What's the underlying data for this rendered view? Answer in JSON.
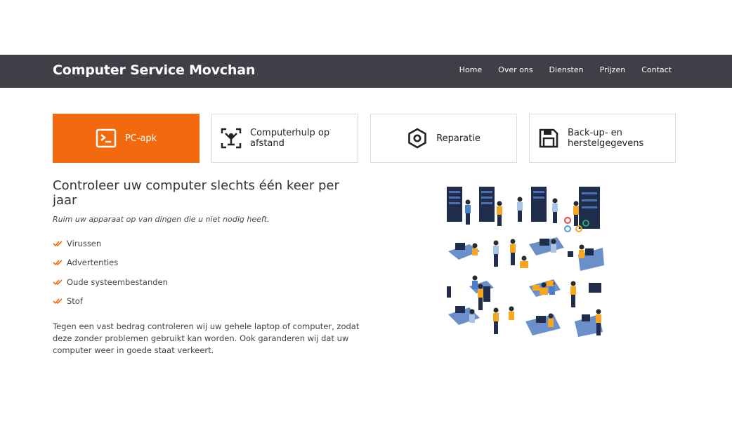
{
  "header": {
    "brand": "Computer Service Movchan",
    "nav": [
      "Home",
      "Over ons",
      "Diensten",
      "Prijzen",
      "Contact"
    ]
  },
  "tabs": [
    {
      "label": "PC-apk",
      "icon": "terminal-icon",
      "active": true
    },
    {
      "label": "Computerhulp op afstand",
      "icon": "remote-support-icon",
      "active": false
    },
    {
      "label": "Reparatie",
      "icon": "hex-nut-icon",
      "active": false
    },
    {
      "label": "Back-up- en herstelgegevens",
      "icon": "floppy-disk-icon",
      "active": false
    }
  ],
  "content": {
    "title": "Controleer uw computer slechts één keer per jaar",
    "subtitle": "Ruim uw apparaat op van dingen die u niet nodig heeft.",
    "list": [
      "Virussen",
      "Advertenties",
      "Oude systeembestanden",
      "Stof"
    ],
    "paragraph": "Tegen een vast bedrag controleren wij uw gehele laptop of computer, zodat deze zonder problemen gebruikt kan worden. Ook garanderen wij dat uw computer weer in goede staat verkeert."
  },
  "colors": {
    "accent": "#f26a0d",
    "navbar": "#3f4047"
  },
  "illustration": "isometric-server-technicians-illustration"
}
